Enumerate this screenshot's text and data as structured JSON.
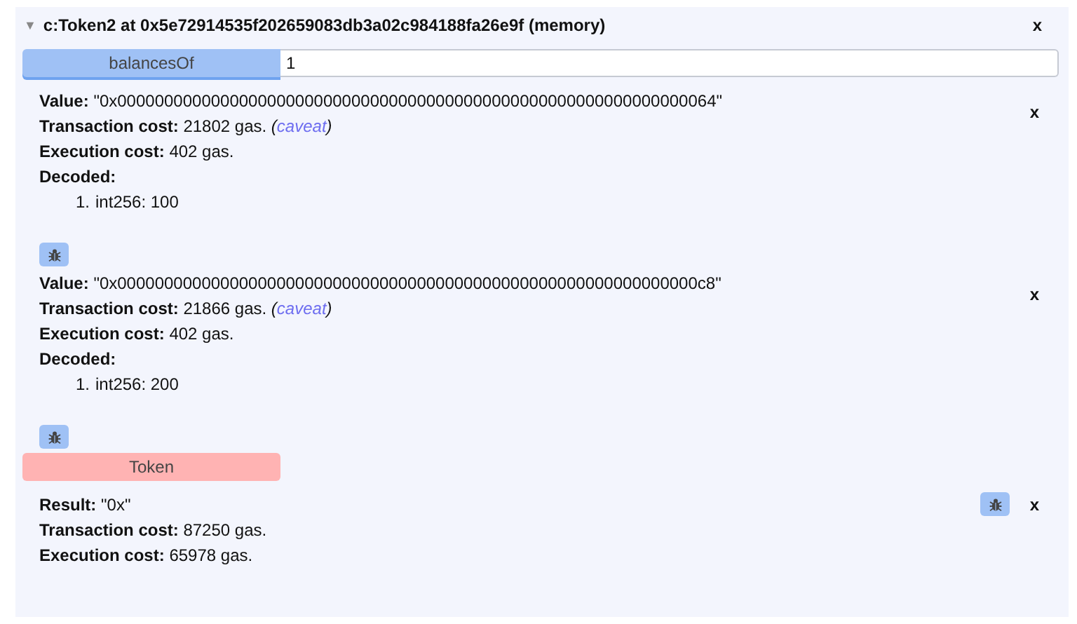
{
  "header": {
    "toggle": "▼",
    "title": "c:Token2 at 0x5e72914535f202659083db3a02c984188fa26e9f (memory)",
    "close": "x"
  },
  "entries": [
    {
      "kind": "function",
      "label": "balancesOf",
      "color": "#9fc1f5",
      "input_value": "1"
    },
    {
      "kind": "result",
      "close": "x",
      "side_debug": false,
      "lines": [
        {
          "text": "**Value:** \"0x0000000000000000000000000000000000000000000000000000000000000064\""
        },
        {
          "text": "**Transaction cost:** 21802 gas.",
          "note": {
            "before": "(",
            "link": "caveat",
            "after": ")"
          }
        },
        {
          "text": "**Execution cost:** 402 gas."
        },
        {
          "text": "**Decoded:**"
        }
      ],
      "decoded": [
        {
          "number": "1.",
          "text": "int256: 100"
        }
      ]
    },
    {
      "kind": "debug"
    },
    {
      "kind": "result",
      "close": "x",
      "side_debug": false,
      "lines": [
        {
          "text": "**Value:** \"0x00000000000000000000000000000000000000000000000000000000000000c8\""
        },
        {
          "text": "**Transaction cost:** 21866 gas.",
          "note": {
            "before": "(",
            "link": "caveat",
            "after": ")"
          }
        },
        {
          "text": "**Execution cost:** 402 gas."
        },
        {
          "text": "**Decoded:**"
        }
      ],
      "decoded": [
        {
          "number": "1.",
          "text": "int256: 200"
        }
      ]
    },
    {
      "kind": "debug"
    },
    {
      "kind": "function",
      "label": "Token",
      "color": "#ffb3b3"
    },
    {
      "kind": "result",
      "close": "x",
      "side_debug": true,
      "lines": [
        {
          "text": "**Result:** \"0x\""
        },
        {
          "text": "**Transaction cost:** 87250 gas."
        },
        {
          "text": "**Execution cost:** 65978 gas."
        }
      ]
    }
  ]
}
